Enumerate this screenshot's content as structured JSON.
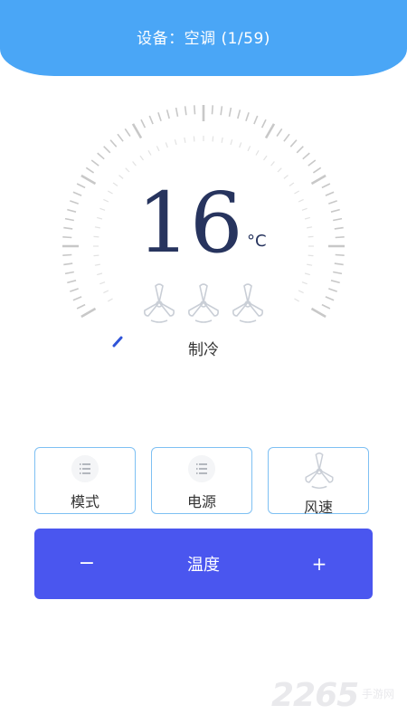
{
  "header": {
    "title": "设备：空调 (1/59)"
  },
  "thermostat": {
    "temperature": "16",
    "unit": "°C",
    "mode": "制冷",
    "fan_icons": [
      "fan-icon",
      "fan-icon",
      "fan-icon"
    ]
  },
  "controls": {
    "mode_label": "模式",
    "power_label": "电源",
    "fan_speed_label": "风速"
  },
  "temp_bar": {
    "minus": "−",
    "label": "温度",
    "plus": "+",
    "color": "#4a56ef"
  },
  "watermark": {
    "number": "2265",
    "text": "手游网"
  },
  "colors": {
    "header": "#4aa6f6",
    "temperature": "#27345e",
    "tile_border": "#7ec0f3",
    "ticks": "#c8c8c8",
    "dial_pointer": "#2f54d8"
  }
}
